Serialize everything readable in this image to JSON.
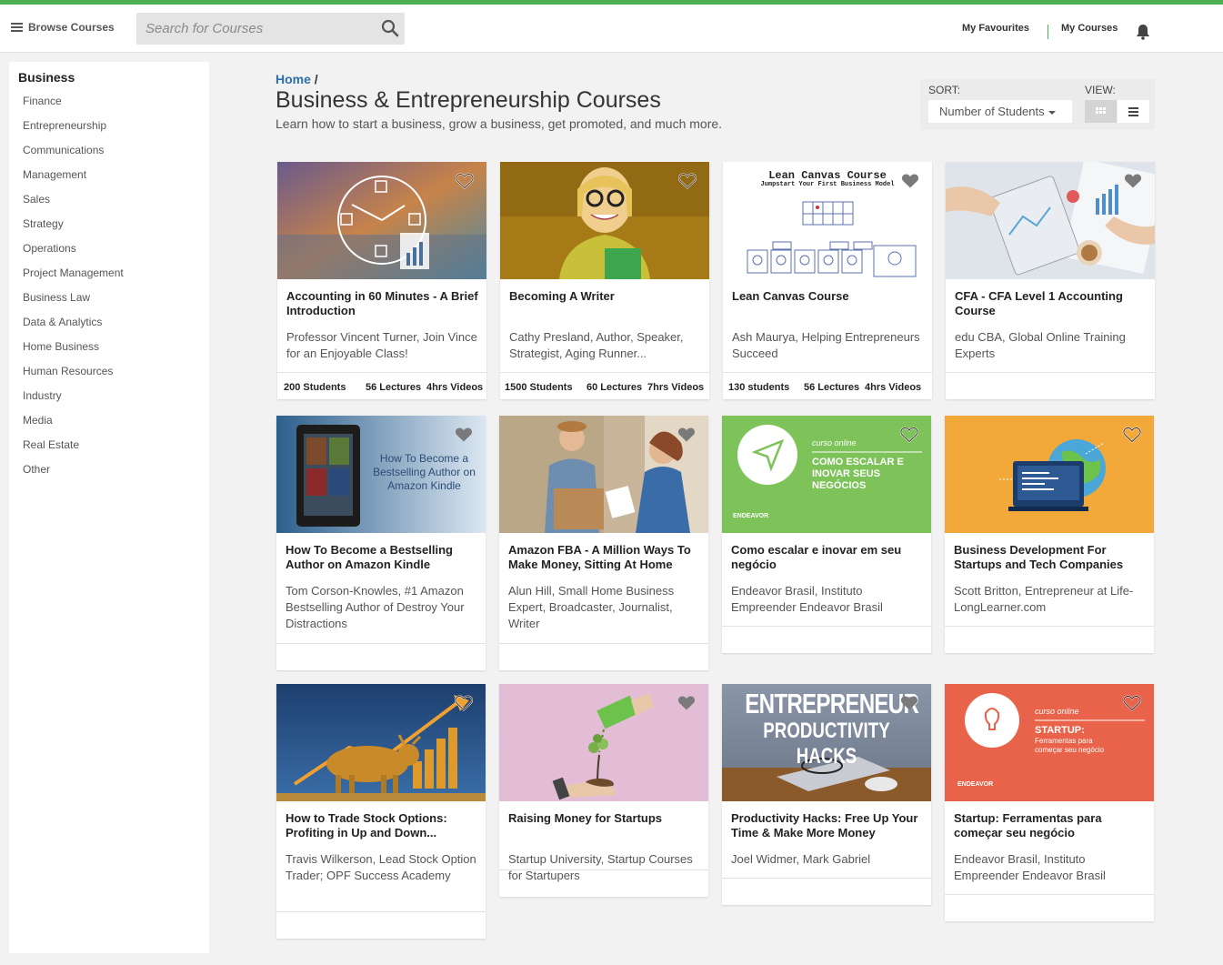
{
  "header": {
    "browse_label": "Browse Courses",
    "search_placeholder": "Search for Courses",
    "my_favourites": "My Favourites",
    "my_courses": "My Courses"
  },
  "sidebar": {
    "heading": "Business",
    "items": [
      "Finance",
      "Entrepreneurship",
      "Communications",
      "Management",
      "Sales",
      "Strategy",
      "Operations",
      "Project Management",
      "Business Law",
      "Data & Analytics",
      "Home Business",
      "Human Resources",
      "Industry",
      "Media",
      "Real Estate",
      "Other"
    ]
  },
  "page": {
    "breadcrumb_home": "Home",
    "breadcrumb_sep": "/",
    "title": "Business & Entrepreneurship Courses",
    "subtitle": "Learn how to start a business, grow a business, get promoted, and much more.",
    "sort_label": "SORT:",
    "sort_value": "Number of Students",
    "view_label": "VIEW:"
  },
  "courses": [
    {
      "title": "Accounting in 60 Minutes - A Brief Introduction",
      "author": "Professor Vincent Turner, Join Vince for an Enjoyable Class!",
      "students": "200 Students",
      "lectures": "56 Lectures",
      "videos": "4hrs Videos"
    },
    {
      "title": "Becoming A Writer",
      "author": "Cathy Presland, Author, Speaker, Strategist, Aging Runner...",
      "students": "1500 Students",
      "lectures": "60 Lectures",
      "videos": "7hrs Videos"
    },
    {
      "title": "Lean Canvas Course",
      "author": "Ash Maurya, Helping Entrepreneurs Succeed",
      "students": "130 students",
      "lectures": "56 Lectures",
      "videos": "4hrs Videos",
      "thumb_title": "Lean Canvas Course",
      "thumb_sub": "Jumpstart Your First Business Model"
    },
    {
      "title": "CFA - CFA Level 1 Accounting Course",
      "author": "edu CBA, Global Online Training Experts",
      "students": "",
      "lectures": "",
      "videos": ""
    },
    {
      "title": "How To Become a Bestselling Author on Amazon Kindle",
      "author": "Tom Corson-Knowles, #1 Amazon Bestselling Author of Destroy Your Distractions",
      "students": "",
      "lectures": "",
      "videos": "",
      "thumb_text": "How To Become a Bestselling Author on Amazon Kindle"
    },
    {
      "title": "Amazon FBA - A Million Ways To Make Money, Sitting At Home",
      "author": "Alun Hill, Small Home Business Expert, Broadcaster, Journalist, Writer",
      "students": "",
      "lectures": "",
      "videos": ""
    },
    {
      "title": "Como escalar e inovar em seu negócio",
      "author": "Endeavor Brasil, Instituto Empreender Endeavor Brasil",
      "students": "",
      "lectures": "",
      "videos": "",
      "thumb_tag": "curso online",
      "thumb_head": "COMO ESCALAR E INOVAR SEUS NEGÓCIOS",
      "thumb_brand": "ENDEAVOR"
    },
    {
      "title": "Business Development For Startups and Tech Companies",
      "author": "Scott Britton, Entrepreneur at Life-LongLearner.com",
      "students": "",
      "lectures": "",
      "videos": ""
    },
    {
      "title": "How to Trade Stock Options: Profiting in Up and Down...",
      "author": "Travis Wilkerson, Lead Stock Option Trader; OPF Success Academy",
      "students": "",
      "lectures": "",
      "videos": ""
    },
    {
      "title": "Raising Money for Startups",
      "author": "Startup University, Startup Courses for Startupers",
      "students": "",
      "lectures": "",
      "videos": ""
    },
    {
      "title": "Productivity Hacks: Free Up Your Time & Make More Money",
      "author": "Joel Widmer, Mark Gabriel",
      "students": "",
      "lectures": "",
      "videos": "",
      "thumb_l1": "ENTREPRENEUR",
      "thumb_l2": "PRODUCTIVITY HACKS"
    },
    {
      "title": "Startup: Ferramentas para começar seu negócio",
      "author": "Endeavor Brasil, Instituto Empreender Endeavor Brasil",
      "students": "",
      "lectures": "",
      "videos": "",
      "thumb_tag": "curso online",
      "thumb_head": "STARTUP:",
      "thumb_sub": "Ferramentas para começar seu negócio",
      "thumb_brand": "ENDEAVOR"
    }
  ],
  "colors": {
    "accent": "#4caf50",
    "link": "#2d6fa8"
  }
}
